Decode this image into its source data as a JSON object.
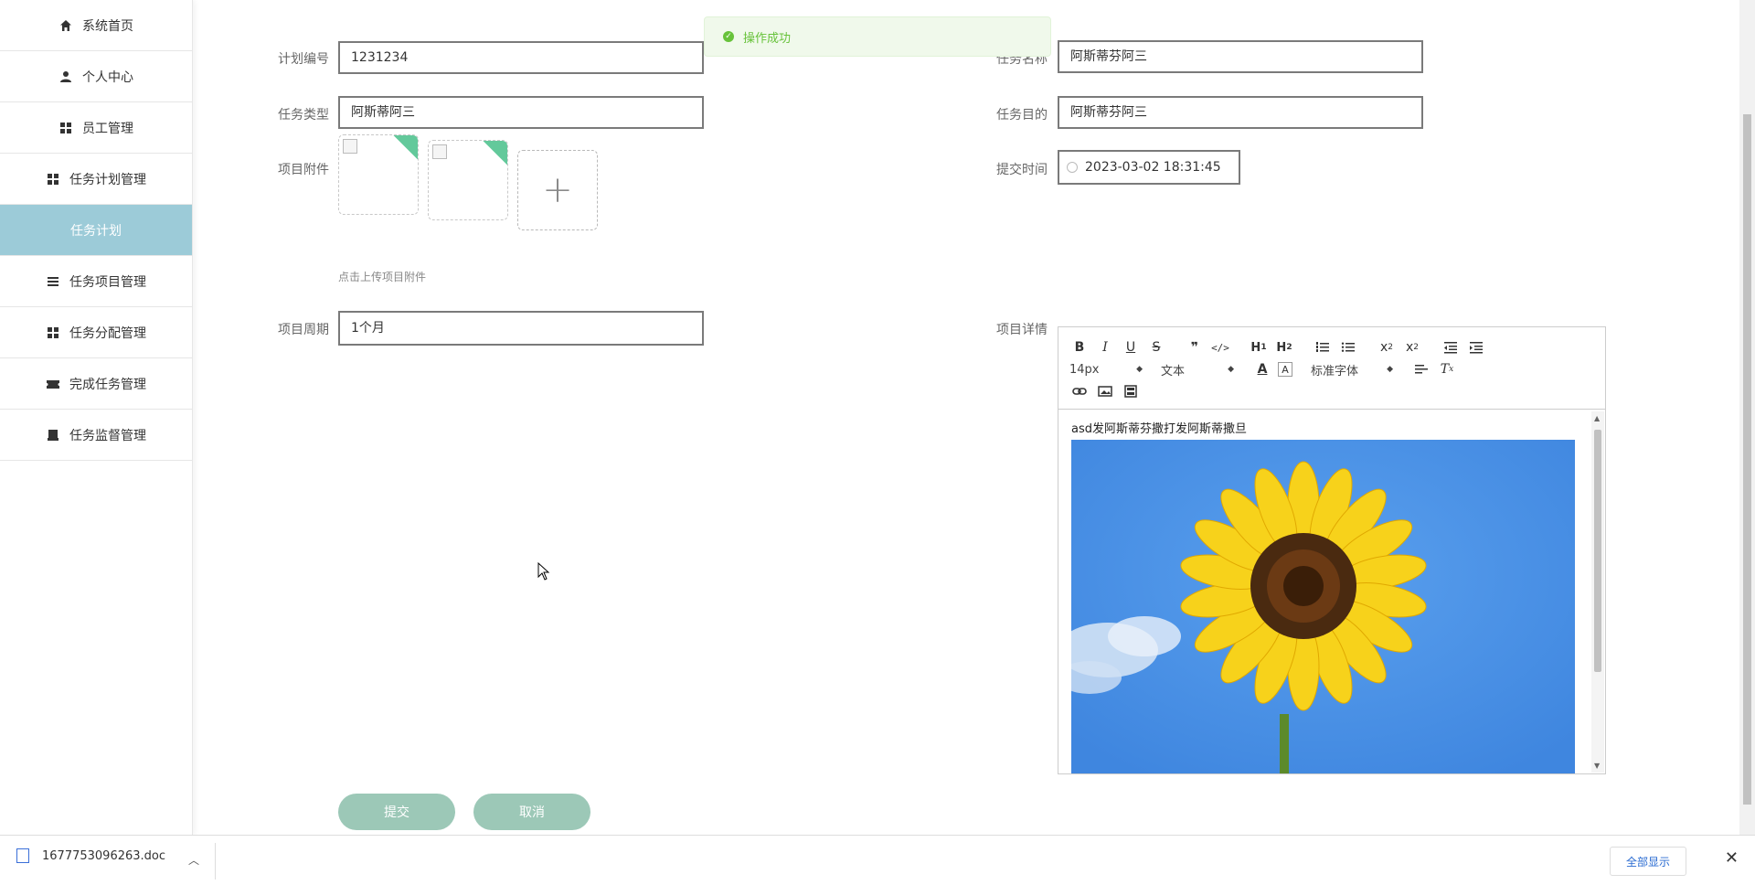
{
  "sidebar": {
    "items": [
      {
        "label": "系统首页",
        "icon": "home-icon"
      },
      {
        "label": "个人中心",
        "icon": "user-icon"
      },
      {
        "label": "员工管理",
        "icon": "grid-icon"
      },
      {
        "label": "任务计划管理",
        "icon": "grid-icon"
      },
      {
        "label": "任务计划",
        "icon": ""
      },
      {
        "label": "任务项目管理",
        "icon": "list-icon"
      },
      {
        "label": "任务分配管理",
        "icon": "grid-icon"
      },
      {
        "label": "完成任务管理",
        "icon": "ticket-icon"
      },
      {
        "label": "任务监督管理",
        "icon": "inbox-icon"
      }
    ]
  },
  "form": {
    "plan_no_label": "计划编号",
    "plan_no_value": "1231234",
    "task_name_label": "任务名称",
    "task_name_value": "阿斯蒂芬阿三",
    "task_type_label": "任务类型",
    "task_type_value": "阿斯蒂阿三",
    "task_goal_label": "任务目的",
    "task_goal_value": "阿斯蒂芬阿三",
    "attachment_label": "项目附件",
    "attachment_hint": "点击上传项目附件",
    "submit_time_label": "提交时间",
    "submit_time_value": "2023-03-02 18:31:45",
    "period_label": "项目周期",
    "period_value": "1个月",
    "detail_label": "项目详情"
  },
  "editor": {
    "font_size": "14px",
    "block_format": "文本",
    "font_family": "标准字体",
    "content_text": "asd发阿斯蒂芬撒打发阿斯蒂撒旦"
  },
  "buttons": {
    "submit": "提交",
    "cancel": "取消"
  },
  "toast": {
    "message": "操作成功"
  },
  "download_bar": {
    "file_name": "1677753096263.doc",
    "show_all": "全部显示"
  },
  "colors": {
    "sidebar_active": "#9ccbd8",
    "button": "#9cc8b7",
    "toast_green": "#67c23a"
  }
}
